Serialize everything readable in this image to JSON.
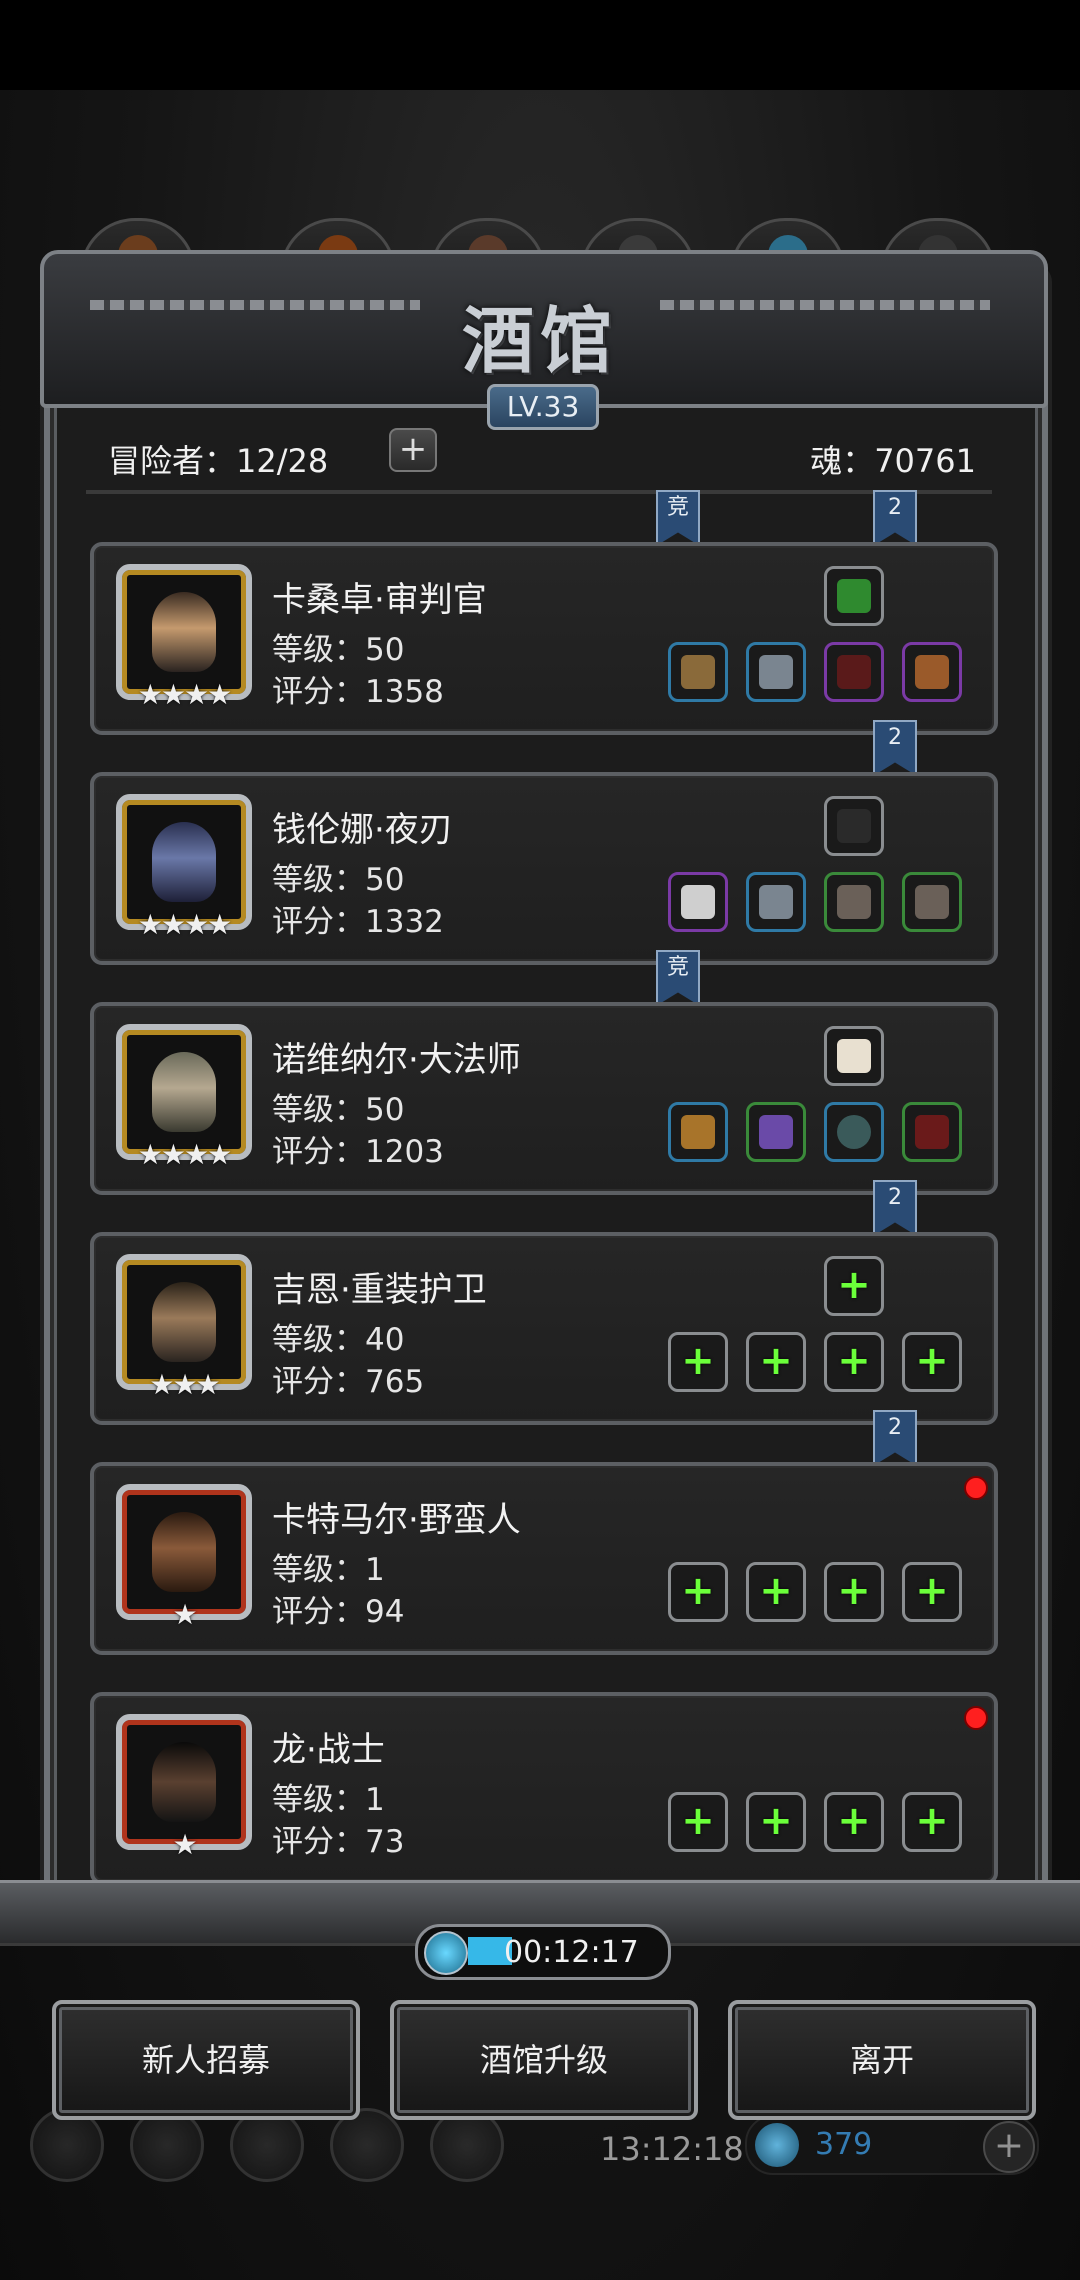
{
  "tavern": {
    "title": "酒馆",
    "level": "LV.33",
    "adventurers_label": "冒险者：12/28",
    "soul_label": "魂：70761"
  },
  "heroes": [
    {
      "name": "卡桑卓·审判官",
      "level": "等级：50",
      "score": "评分：1358",
      "stars": "★★★★",
      "frame": "gold",
      "top_badges": [
        "竞",
        "2"
      ],
      "artifact_icon": "green-tome-icon",
      "equipment_icons": [
        "hammer-icon",
        "chest-armor-icon",
        "purple-gem-icon",
        "scroll-icon"
      ]
    },
    {
      "name": "钱伦娜·夜刃",
      "level": "等级：50",
      "score": "评分：1332",
      "stars": "★★★★",
      "frame": "gold",
      "top_badges": [
        "2"
      ],
      "artifact_icon": "dark-claw-icon",
      "equipment_icons": [
        "curved-blade-icon",
        "chest-armor-icon",
        "gauntlet-icon",
        "gauntlet-icon"
      ]
    },
    {
      "name": "诺维纳尔·大法师",
      "level": "等级：50",
      "score": "评分：1203",
      "stars": "★★★★",
      "frame": "gold",
      "top_badges": [
        "竞"
      ],
      "artifact_icon": "fang-icon",
      "equipment_icons": [
        "staff-icon",
        "purple-armor-icon",
        "ring-icon",
        "red-gem-icon"
      ]
    },
    {
      "name": "吉恩·重装护卫",
      "level": "等级：40",
      "score": "评分：765",
      "stars": "★★★",
      "frame": "gold",
      "top_badges": [
        "2"
      ],
      "artifact_icon": "add-slot-icon",
      "equipment_icons": [
        "add-slot-icon",
        "add-slot-icon",
        "add-slot-icon",
        "add-slot-icon"
      ]
    },
    {
      "name": "卡特马尔·野蛮人",
      "level": "等级：1",
      "score": "评分：94",
      "stars": "★",
      "frame": "red",
      "top_badges": [
        "2"
      ],
      "artifact_icon": "",
      "equipment_icons": [
        "add-slot-icon",
        "add-slot-icon",
        "add-slot-icon",
        "add-slot-icon"
      ]
    },
    {
      "name": "龙·战士",
      "level": "等级：1",
      "score": "评分：73",
      "stars": "★",
      "frame": "red",
      "top_badges": [],
      "artifact_icon": "",
      "equipment_icons": [
        "add-slot-icon",
        "add-slot-icon",
        "add-slot-icon",
        "add-slot-icon"
      ]
    }
  ],
  "timer": "00:12:17",
  "buttons": {
    "recruit": "新人招募",
    "upgrade": "酒馆升级",
    "leave": "离开"
  },
  "background": {
    "clock": "13:12:18",
    "currency": "379"
  },
  "colors": {
    "accent_blue": "#2a4b74",
    "plus_green": "#6bff3a",
    "alert_red": "#ff1f1f",
    "frame_gold": "#b58a22",
    "frame_red": "#b0341c"
  }
}
